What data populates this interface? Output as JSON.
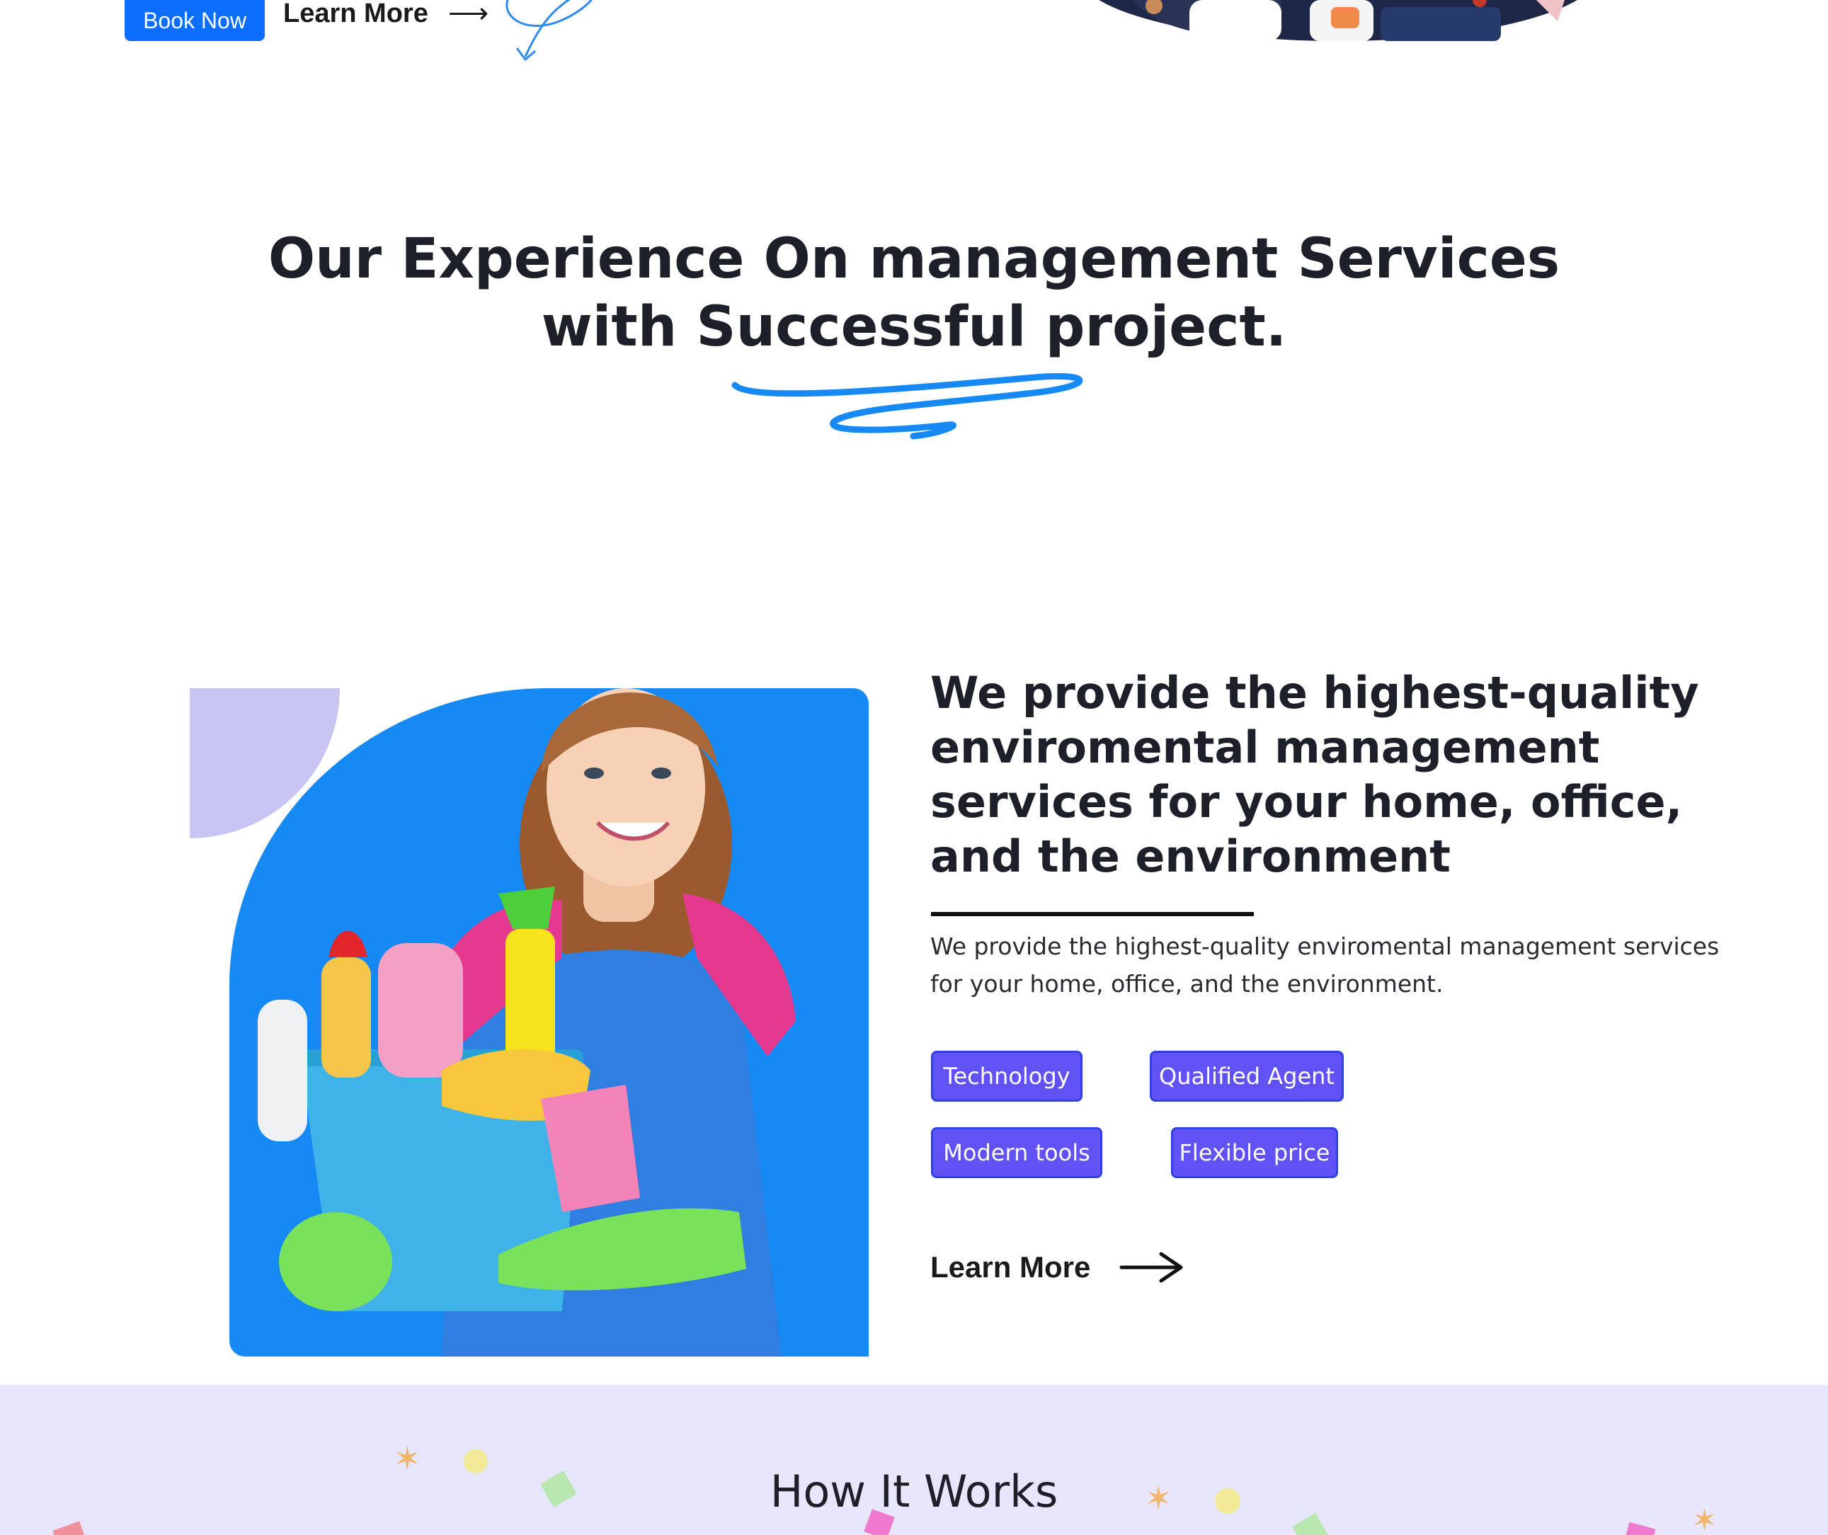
{
  "hero": {
    "book_label": "Book Now",
    "learn_label": "Learn More"
  },
  "experience": {
    "title_line1": "Our Experience On management Services",
    "title_line2": "with Successful project."
  },
  "about": {
    "heading": "We provide the highest-quality enviromental management services for your home, office, and the environment",
    "text": "We provide the highest-quality enviromental management services for your home, office, and the environment.",
    "tags": [
      "Technology",
      "Qualified Agent",
      "Modern tools",
      "Flexible price"
    ],
    "learn_label": "Learn More"
  },
  "how": {
    "title": "How It Works"
  },
  "colors": {
    "primary": "#0d6efd",
    "tag_bg": "#6052f5",
    "panel_blue": "#1689f5",
    "lavender": "#e7e6fd"
  },
  "icons": [
    "arrow-right-icon",
    "squiggle-underline",
    "scribble-arrow"
  ]
}
